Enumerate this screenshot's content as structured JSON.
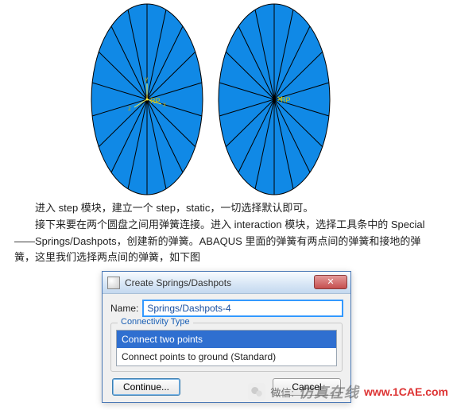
{
  "diagram": {
    "rp_label_left": "RP",
    "rp_label_right": "RP",
    "axis_x": "x",
    "axis_y": "y",
    "axis_z": "z"
  },
  "text": {
    "p1": "进入 step 模块，建立一个 step，static，一切选择默认即可。",
    "p2": "接下来要在两个圆盘之间用弹簧连接。进入 interaction 模块，选择工具条中的 Special ——Springs/Dashpots，创建新的弹簧。ABAQUS 里面的弹簧有两点间的弹簧和接地的弹簧，这里我们选择两点间的弹簧，如下图"
  },
  "dialog": {
    "title": "Create Springs/Dashpots",
    "close_glyph": "✕",
    "name_label": "Name:",
    "name_value": "Springs/Dashpots-4",
    "group_label": "Connectivity Type",
    "options": {
      "opt1": "Connect two points",
      "opt2": "Connect points to ground (Standard)"
    },
    "continue_label": "Continue...",
    "cancel_label": "Cancel"
  },
  "watermark": {
    "wx_label": "微信:",
    "brand": "仿真在线",
    "url": "www.1CAE.com"
  }
}
